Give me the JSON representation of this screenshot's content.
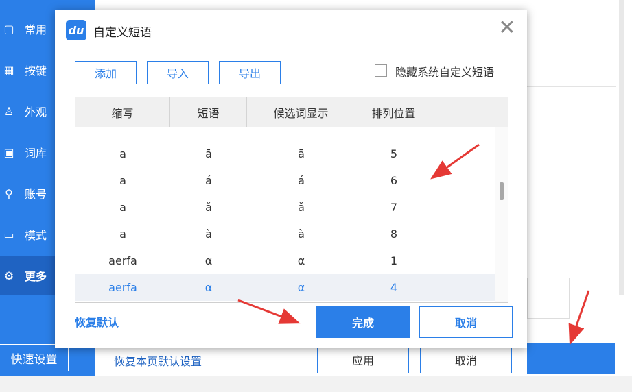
{
  "sidebar": {
    "items": [
      {
        "icon": "window-icon",
        "glyph": "▢",
        "label": "常用",
        "active": false
      },
      {
        "icon": "keyboard-icon",
        "glyph": "▦",
        "label": "按键",
        "active": false
      },
      {
        "icon": "shirt-icon",
        "glyph": "♙",
        "label": "外观",
        "active": false
      },
      {
        "icon": "dictionary-icon",
        "glyph": "▣",
        "label": "词库",
        "active": false
      },
      {
        "icon": "user-icon",
        "glyph": "⚲",
        "label": "账号",
        "active": false
      },
      {
        "icon": "mode-icon",
        "glyph": "▭",
        "label": "模式",
        "active": false
      },
      {
        "icon": "gear-icon",
        "glyph": "⚙",
        "label": "更多",
        "active": true
      }
    ],
    "quick_settings": "快速设置"
  },
  "background": {
    "restore_page_defaults": "恢复本页默认设置",
    "apply": "应用",
    "cancel": "取消"
  },
  "dialog": {
    "logo": "du",
    "title": "自定义短语",
    "close": "✕",
    "toolbar": {
      "add": "添加",
      "import": "导入",
      "export": "导出"
    },
    "hide_system_label": "隐藏系统自定义短语",
    "table": {
      "headers": [
        "缩写",
        "短语",
        "候选词显示",
        "排列位置"
      ],
      "rows": [
        {
          "abbr": "a",
          "phrase": "ā",
          "candidate": "ā",
          "position": "5",
          "selected": false
        },
        {
          "abbr": "a",
          "phrase": "á",
          "candidate": "á",
          "position": "6",
          "selected": false
        },
        {
          "abbr": "a",
          "phrase": "ǎ",
          "candidate": "ǎ",
          "position": "7",
          "selected": false
        },
        {
          "abbr": "a",
          "phrase": "à",
          "candidate": "à",
          "position": "8",
          "selected": false
        },
        {
          "abbr": "aerfa",
          "phrase": "α",
          "candidate": "α",
          "position": "1",
          "selected": false
        },
        {
          "abbr": "aerfa",
          "phrase": "α",
          "candidate": "α",
          "position": "4",
          "selected": true
        }
      ]
    },
    "restore_default": "恢复默认",
    "done": "完成",
    "cancel": "取消"
  },
  "colors": {
    "accent": "#2b7fe8",
    "arrow": "#e53935"
  }
}
